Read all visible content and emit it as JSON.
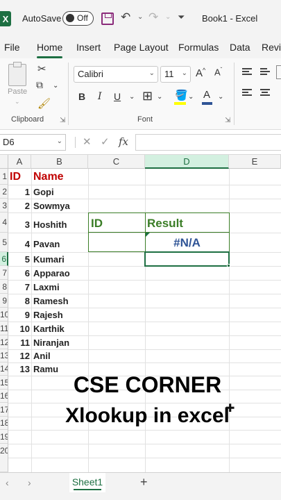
{
  "titlebar": {
    "logo": "X",
    "autosave_label": "AutoSave",
    "autosave_state": "Off",
    "document_title": "Book1  -  Excel",
    "icons": [
      "excel-logo-icon",
      "save-icon",
      "undo-icon",
      "redo-icon",
      "customize-qat-icon"
    ]
  },
  "tabs": [
    "File",
    "Home",
    "Insert",
    "Page Layout",
    "Formulas",
    "Data",
    "Revie"
  ],
  "active_tab": "Home",
  "ribbon": {
    "clipboard": {
      "paste_label": "Paste",
      "group_label": "Clipboard"
    },
    "font": {
      "font_name": "Calibri",
      "font_size": "11",
      "bold": "B",
      "italic": "I",
      "underline": "U",
      "font_color_glyph": "A",
      "group_label": "Font"
    }
  },
  "formula_bar": {
    "name_box": "D6",
    "fx_label": "fx",
    "formula": ""
  },
  "sheet": {
    "columns": [
      "A",
      "B",
      "C",
      "D",
      "E"
    ],
    "selected_column": "D",
    "selected_row": "6",
    "rows": [
      "1",
      "2",
      "3",
      "4",
      "5",
      "6",
      "7",
      "8",
      "9",
      "10",
      "11",
      "12",
      "13",
      "14",
      "15",
      "16",
      "17",
      "18",
      "19",
      "20"
    ],
    "headers": {
      "id": "ID",
      "name": "Name"
    },
    "records": [
      {
        "id": "1",
        "name": "Gopi"
      },
      {
        "id": "2",
        "name": "Sowmya"
      },
      {
        "id": "3",
        "name": "Hoshith"
      },
      {
        "id": "4",
        "name": "Pavan"
      },
      {
        "id": "5",
        "name": "Kumari"
      },
      {
        "id": "6",
        "name": "Apparao"
      },
      {
        "id": "7",
        "name": "Laxmi"
      },
      {
        "id": "8",
        "name": "Ramesh"
      },
      {
        "id": "9",
        "name": "Rajesh"
      },
      {
        "id": "10",
        "name": "Karthik"
      },
      {
        "id": "11",
        "name": "Niranjan"
      },
      {
        "id": "12",
        "name": "Anil"
      },
      {
        "id": "13",
        "name": "Ramu"
      }
    ],
    "lookup": {
      "id_header": "ID",
      "result_header": "Result",
      "id_value": "",
      "result_value": "#N/A"
    },
    "colors": {
      "header_red": "#c00000",
      "header_green": "#3a7d26",
      "error_blue": "#2f5496",
      "excel_green": "#1d6f42"
    }
  },
  "overlay": {
    "line1": "CSE CORNER",
    "line2": "Xlookup in excel"
  },
  "sheet_tabs": {
    "active": "Sheet1",
    "add_icon": "+",
    "prev_icon": "‹",
    "next_icon": "›"
  }
}
